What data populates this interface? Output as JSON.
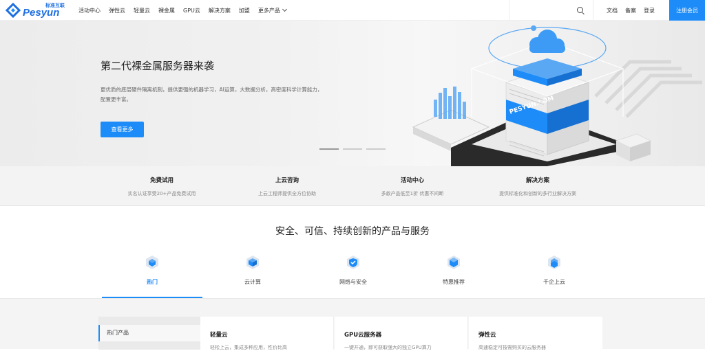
{
  "nav": {
    "logo_text": "Pesyun",
    "logo_sub": "标准互联",
    "menu": [
      "活动中心",
      "弹性云",
      "轻量云",
      "裸金属",
      "GPU云",
      "解决方案",
      "加盟",
      "更多产品"
    ],
    "right_links": [
      "文档",
      "备案",
      "登录"
    ],
    "register_label": "注册会员"
  },
  "hero": {
    "title": "第二代裸金属服务器来袭",
    "desc": "更优质的底层硬件隔离机制，提供更强的机器学习，AI运算，大数据分析，高密度科学计算能力，配置更丰富。",
    "button": "查看更多",
    "art_label": "PESYUN.COM",
    "slides_total": 3,
    "slide_active": 1
  },
  "quick": [
    {
      "title": "免费试用",
      "sub": "实名认证享受20+产品免费试用"
    },
    {
      "title": "上云咨询",
      "sub": "上云工程师提供全方位协助"
    },
    {
      "title": "活动中心",
      "sub": "多款产品低至1折 优惠不间断"
    },
    {
      "title": "解决方案",
      "sub": "提供标准化和创新的多行业解决方案"
    }
  ],
  "section": {
    "title": "安全、可信、持续创新的产品与服务"
  },
  "tabs": [
    {
      "label": "热门",
      "active": true
    },
    {
      "label": "云计算",
      "active": false
    },
    {
      "label": "网络与安全",
      "active": false
    },
    {
      "label": "特惠推荐",
      "active": false
    },
    {
      "label": "千企上云",
      "active": false
    }
  ],
  "sidebar": {
    "items": [
      "热门产品"
    ]
  },
  "cards": [
    {
      "title": "轻量云",
      "desc": "轻松上云，集成多种应用，性价比高"
    },
    {
      "title": "GPU云服务器",
      "desc": "一键开通，即可获取强大的独立GPU算力"
    },
    {
      "title": "弹性云",
      "desc": "高速稳定可按需购买的云服务器"
    }
  ],
  "colors": {
    "accent": "#1d8cf8",
    "brand": "#1d6fe0"
  }
}
